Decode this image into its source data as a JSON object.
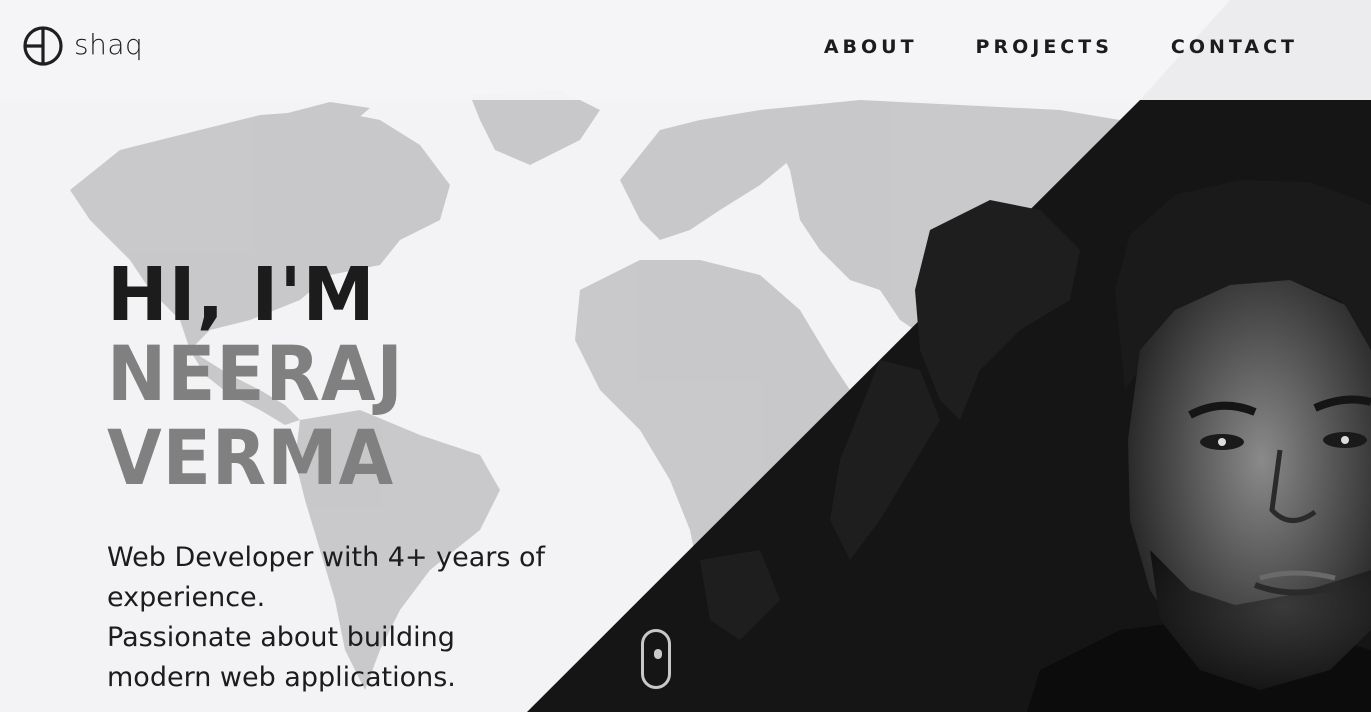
{
  "brand": {
    "logo_text": "shaq",
    "logo_icon": "circle-monogram-icon"
  },
  "nav": {
    "items": [
      {
        "label": "ABOUT"
      },
      {
        "label": "PROJECTS"
      },
      {
        "label": "CONTACT"
      }
    ]
  },
  "hero": {
    "greeting": "HI, I'M",
    "name_line1": "NEERAJ",
    "name_line2": "VERMA",
    "description_line1": "Web Developer with 4+ years of experience.",
    "description_line2": "Passionate about building modern web applications."
  },
  "scroll_indicator": {
    "icon": "mouse-scroll-icon"
  },
  "colors": {
    "background": "#f3f3f5",
    "dark_panel": "#151515",
    "text_primary": "#1c1c1c",
    "text_name": "#808080",
    "map": "#c9c9c9"
  }
}
